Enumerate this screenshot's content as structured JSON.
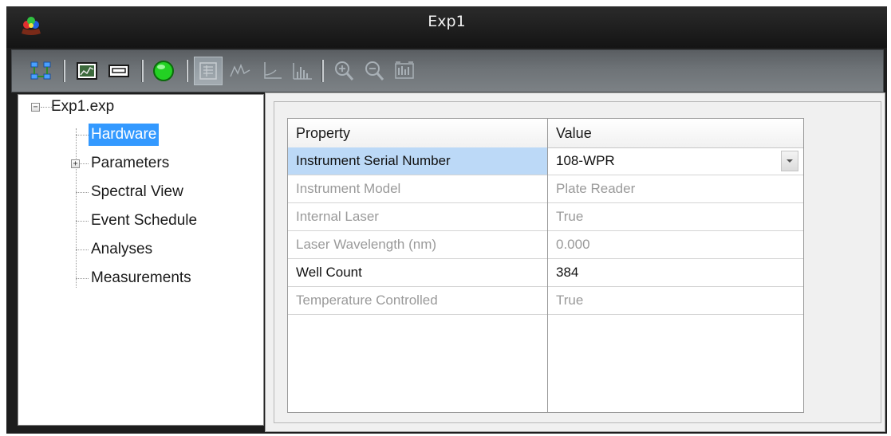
{
  "window": {
    "title": "Exp1"
  },
  "toolbar": {
    "buttons": [
      {
        "name": "network-icon",
        "enabled": true
      },
      {
        "name": "chart-view-icon",
        "enabled": true
      },
      {
        "name": "window-icon",
        "enabled": true
      },
      {
        "name": "run-status-icon",
        "enabled": true,
        "color": "#22cc22"
      },
      {
        "name": "property-grid-icon",
        "enabled": false,
        "pressed": true
      },
      {
        "name": "spectrum-icon",
        "enabled": false
      },
      {
        "name": "axis-icon",
        "enabled": false
      },
      {
        "name": "histogram-icon",
        "enabled": false
      },
      {
        "name": "zoom-in-icon",
        "enabled": false
      },
      {
        "name": "zoom-out-icon",
        "enabled": false
      },
      {
        "name": "zoom-fit-icon",
        "enabled": false
      }
    ]
  },
  "tree": {
    "root": {
      "label": "Exp1.exp",
      "toggle": "−"
    },
    "items": [
      {
        "label": "Hardware",
        "selected": true
      },
      {
        "label": "Parameters",
        "toggle": "+"
      },
      {
        "label": "Spectral View"
      },
      {
        "label": "Event Schedule"
      },
      {
        "label": "Analyses"
      },
      {
        "label": "Measurements"
      }
    ]
  },
  "property_grid": {
    "headers": {
      "property": "Property",
      "value": "Value"
    },
    "rows": [
      {
        "property": "Instrument Serial Number",
        "value": "108-WPR",
        "enabled": true,
        "selected": true,
        "dropdown": true
      },
      {
        "property": "Instrument Model",
        "value": "Plate Reader",
        "enabled": false
      },
      {
        "property": "Internal Laser",
        "value": "True",
        "enabled": false
      },
      {
        "property": "Laser Wavelength (nm)",
        "value": "0.000",
        "enabled": false
      },
      {
        "property": "Well Count",
        "value": "384",
        "enabled": true
      },
      {
        "property": "Temperature Controlled",
        "value": "True",
        "enabled": false
      }
    ]
  },
  "colors": {
    "selection": "#3399ff",
    "row_highlight": "#bcd9f7",
    "disabled_text": "#9a9a9a"
  }
}
